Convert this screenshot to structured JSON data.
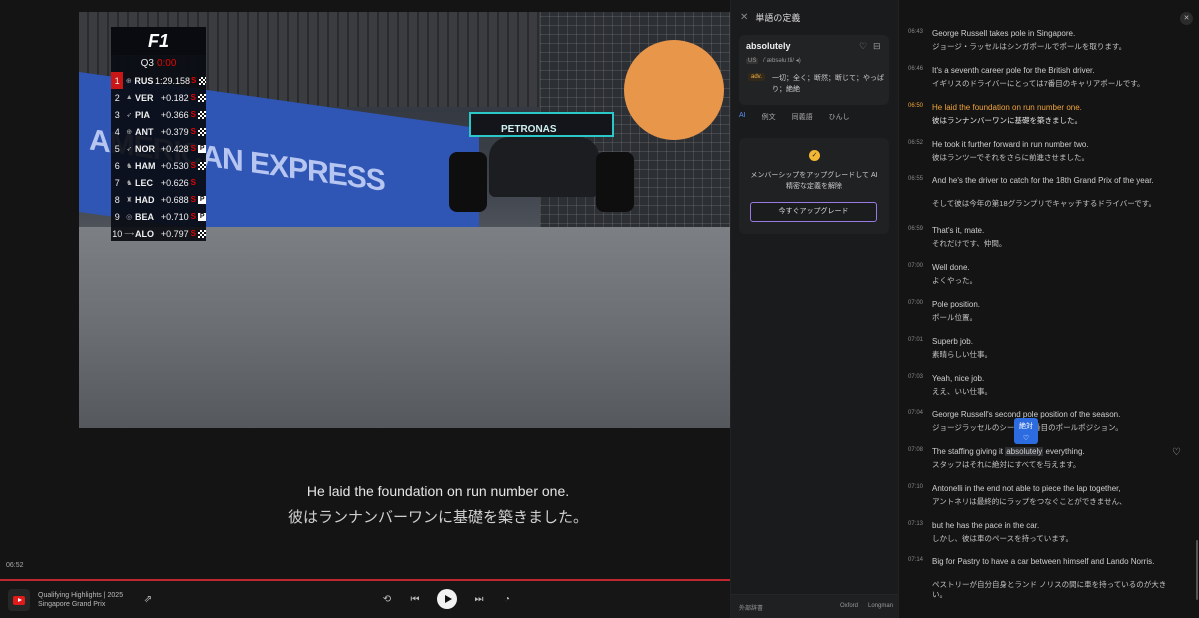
{
  "video": {
    "standings": {
      "logo": "F1",
      "session": "Q3",
      "timer": "0:00",
      "rows": [
        {
          "pos": "1",
          "drv": "RUS",
          "gap": "1:29.158",
          "tyre": "S",
          "flag": "chequered"
        },
        {
          "pos": "2",
          "drv": "VER",
          "gap": "+0.182",
          "tyre": "S",
          "flag": "chequered"
        },
        {
          "pos": "3",
          "drv": "PIA",
          "gap": "+0.366",
          "tyre": "S",
          "flag": "chequered"
        },
        {
          "pos": "4",
          "drv": "ANT",
          "gap": "+0.379",
          "tyre": "S",
          "flag": "chequered"
        },
        {
          "pos": "5",
          "drv": "NOR",
          "gap": "+0.428",
          "tyre": "S",
          "flag": "P"
        },
        {
          "pos": "6",
          "drv": "HAM",
          "gap": "+0.530",
          "tyre": "S",
          "flag": "chequered"
        },
        {
          "pos": "7",
          "drv": "LEC",
          "gap": "+0.626",
          "tyre": "S",
          "flag": ""
        },
        {
          "pos": "8",
          "drv": "HAD",
          "gap": "+0.688",
          "tyre": "S",
          "flag": "P"
        },
        {
          "pos": "9",
          "drv": "BEA",
          "gap": "+0.710",
          "tyre": "S",
          "flag": "P"
        },
        {
          "pos": "10",
          "drv": "ALO",
          "gap": "+0.797",
          "tyre": "S",
          "flag": "chequered"
        }
      ]
    },
    "wall_text": "AMERICAN EXPRESS",
    "car_sponsor": "PETRONAS",
    "subtitle_en": "He laid the foundation on run number one.",
    "subtitle_ja": "彼はランナンバーワンに基礎を築きました。",
    "time_label": "06:52"
  },
  "player": {
    "title_line1": "Qualifying Highlights | 2025",
    "title_line2": "Singapore Grand Prix",
    "accent": "#c0262f"
  },
  "dictionary": {
    "title": "単語の定義",
    "word": "absolutely",
    "region": "US",
    "phonetic": "/ˈæbsəluːtli/",
    "pos": "adv.",
    "definition": "一切；全く；断然；断じて；やっぱり；絶絶",
    "tabs": [
      "AI",
      "例文",
      "同義語",
      "ひんし"
    ],
    "upgrade_msg": "メンバーシップをアップグレードして AI 精密な定義を解除",
    "upgrade_btn": "今すぐアップグレード",
    "footer_ext": "外部辞書",
    "footer_oxford": "Oxford",
    "footer_longman": "Longman"
  },
  "transcript": {
    "rows": [
      {
        "ts": "06:43",
        "en": "George Russell takes pole in Singapore.",
        "ja": "ジョージ・ラッセルはシンガポールでポールを取ります。"
      },
      {
        "ts": "06:46",
        "en": "It's a seventh career pole for the British driver.",
        "ja": "イギリスのドライバーにとっては7番目のキャリアポールです。"
      },
      {
        "ts": "06:50",
        "en": "He laid the foundation on run number one.",
        "ja": "彼はランナンバーワンに基礎を築きました。",
        "active": true
      },
      {
        "ts": "06:52",
        "en": "He took it further forward in run number two.",
        "ja": "彼はランツーでそれをさらに前進させました。"
      },
      {
        "ts": "06:55",
        "en": "And he's the driver to catch for the 18th Grand Prix of the year.",
        "ja": "そして彼は今年の第18グランプリでキャッチするドライバーです。"
      },
      {
        "ts": "06:59",
        "en": "That's it, mate.",
        "ja": "それだけです、仲間。"
      },
      {
        "ts": "07:00",
        "en": "Well done.",
        "ja": "よくやった。"
      },
      {
        "ts": "07:00",
        "en": "Pole position.",
        "ja": "ポール位置。"
      },
      {
        "ts": "07:01",
        "en": "Superb job.",
        "ja": "素晴らしい仕事。"
      },
      {
        "ts": "07:03",
        "en": "Yeah, nice job.",
        "ja": "ええ、いい仕事。"
      },
      {
        "ts": "07:04",
        "en": "George Russell's second pole position of the season.",
        "ja": "ジョージラッセルのシーズン2番目のポールポジション。"
      },
      {
        "ts": "07:08",
        "en_pre": "The staffing giving it ",
        "en_hl": "absolutely",
        "en_post": " everything.",
        "ja": "スタッフはそれに絶対にすべてを与えます。"
      },
      {
        "ts": "07:10",
        "en": "Antonelli in the end not able to piece the lap together,",
        "ja": "アントネリは最終的にラップをつなぐことができません、"
      },
      {
        "ts": "07:13",
        "en": "but he has the pace in the car.",
        "ja": "しかし、彼は車のペースを持っています。"
      },
      {
        "ts": "07:14",
        "en": "Big for Pastry to have a car between himself and Lando Norris.",
        "ja": "ペストリーが自分自身とランド ノリスの間に車を持っているのが大きい。"
      }
    ],
    "tooltip": "絶対"
  }
}
